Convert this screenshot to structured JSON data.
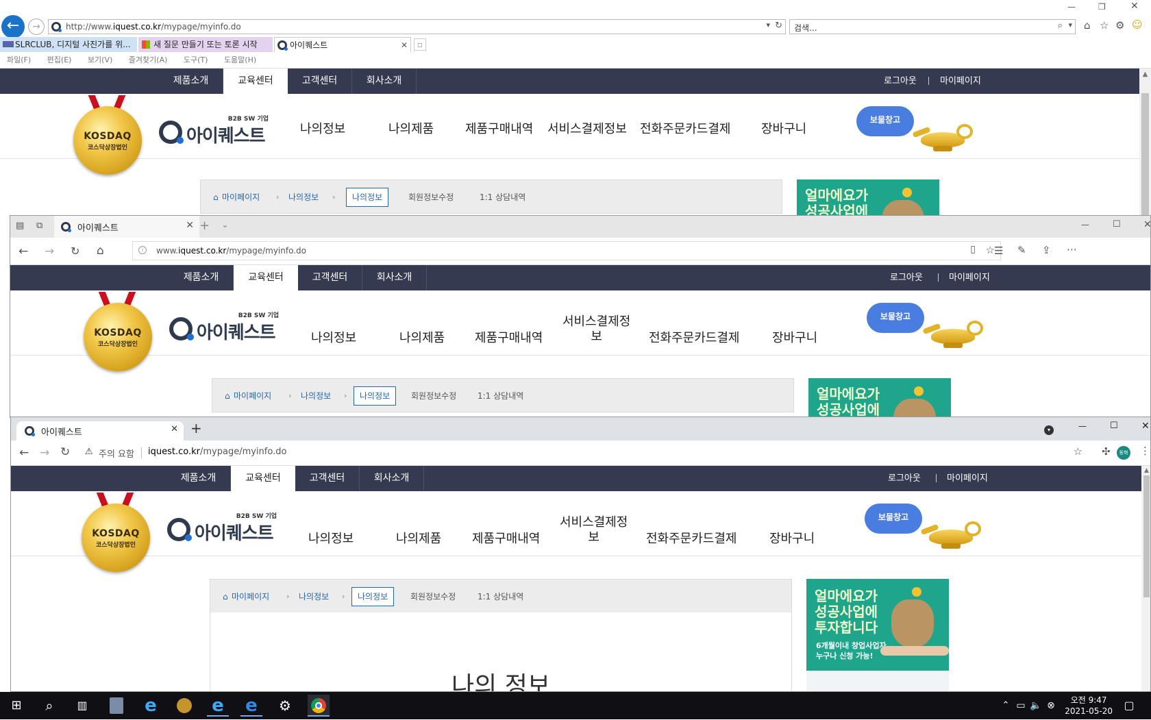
{
  "ie": {
    "url_prefix": "http://www.",
    "url_host": "iquest.co.kr",
    "url_path": "/mypage/myinfo.do",
    "search_placeholder": "검색...",
    "tabs": [
      {
        "label": "SLRCLUB, 디지털 사진가를 위..."
      },
      {
        "label": "새 질문 만들기 또는 토론 시작"
      },
      {
        "label": "아이퀘스트"
      }
    ],
    "menu": [
      "파일(F)",
      "편집(E)",
      "보기(V)",
      "즐겨찾기(A)",
      "도구(T)",
      "도움말(H)"
    ]
  },
  "edge": {
    "tab_label": "아이퀘스트",
    "url_prefix": "www.",
    "url_host": "iquest.co.kr",
    "url_path": "/mypage/myinfo.do"
  },
  "chrome": {
    "tab_label": "아이퀘스트",
    "security": "주의 요함",
    "url_host": "iquest.co.kr",
    "url_path": "/mypage/myinfo.do",
    "profile": "동혁"
  },
  "site": {
    "top_tabs": [
      "제품소개",
      "교육센터",
      "고객센터",
      "회사소개"
    ],
    "logout": "로그아웃",
    "mypage": "마이페이지",
    "medal_line1": "KOSDAQ",
    "medal_line2": "코스닥상장법인",
    "logo_tag": "B2B SW 기업",
    "logo_name": "아이퀘스트",
    "menu": [
      "나의정보",
      "나의제품",
      "제품구매내역",
      "서비스결제정보",
      "전화주문카드결제",
      "장바구니"
    ],
    "menu_wrapped_a": "서비스결제정",
    "menu_wrapped_b": "보",
    "treasure": "보물창고",
    "crumb_home": "마이페이지",
    "crumb_sec": "나의정보",
    "crumb_active": "나의정보",
    "crumb_edit": "회원정보수정",
    "crumb_qna": "1:1 상담내역",
    "banner_title": "얼마에요가\n성공사업에\n투자합니다",
    "banner_sub": "6개월이내 창업사업자\n누구나 신청 가능!",
    "page_heading": "나의 정보"
  },
  "taskbar": {
    "time": "오전 9:47",
    "date": "2021-05-20"
  }
}
